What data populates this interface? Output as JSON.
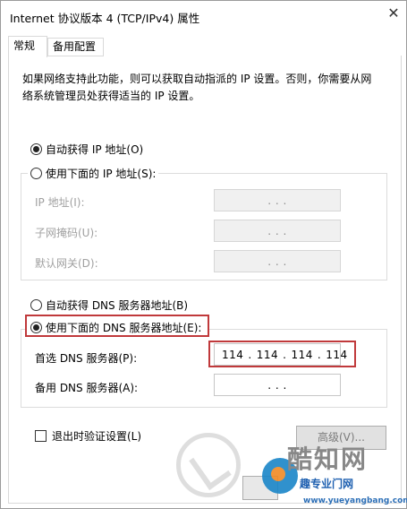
{
  "window": {
    "title": "Internet 协议版本 4 (TCP/IPv4) 属性",
    "close_glyph": "✕"
  },
  "tabs": [
    {
      "label": "常规",
      "active": true
    },
    {
      "label": "备用配置",
      "active": false
    }
  ],
  "description": "如果网络支持此功能，则可以获取自动指派的 IP 设置。否则，你需要从网络系统管理员处获得适当的 IP 设置。",
  "ip_section": {
    "auto_label": "自动获得 IP 地址(O)",
    "auto_selected": true,
    "manual_label": "使用下面的 IP 地址(S):",
    "manual_selected": false,
    "fields": [
      {
        "label": "IP 地址(I):",
        "value": ". . ."
      },
      {
        "label": "子网掩码(U):",
        "value": ". . ."
      },
      {
        "label": "默认网关(D):",
        "value": ". . ."
      }
    ]
  },
  "dns_section": {
    "auto_label": "自动获得 DNS 服务器地址(B)",
    "auto_selected": false,
    "manual_label": "使用下面的 DNS 服务器地址(E):",
    "manual_selected": true,
    "preferred": {
      "label": "首选 DNS 服务器(P):",
      "octets": [
        "114",
        "114",
        "114",
        "114"
      ]
    },
    "alternate": {
      "label": "备用 DNS 服务器(A):",
      "value": ". . ."
    }
  },
  "footer": {
    "validate_label": "退出时验证设置(L)",
    "validate_checked": false,
    "advanced_label": "高级(V)..."
  },
  "watermark": {
    "brand": "酷知网",
    "sub": "趣专业门网",
    "url": "www.yueyangbang.com"
  },
  "colors": {
    "highlight": "#c0393b",
    "border": "#dcdcdc"
  }
}
